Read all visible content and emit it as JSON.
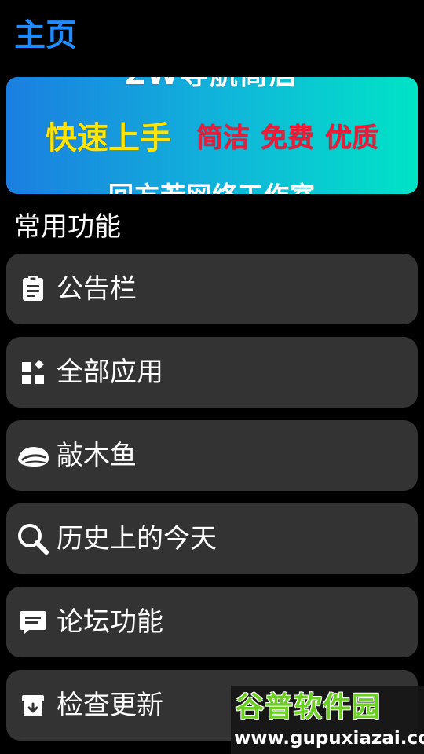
{
  "header": {
    "title": "主页"
  },
  "banner": {
    "top_text": "ZW导航商店",
    "main_text": "快速上手",
    "tags": [
      "简洁",
      "免费",
      "优质"
    ],
    "bottom_text": "回方若网络工作室"
  },
  "section": {
    "title": "常用功能"
  },
  "menu": {
    "items": [
      {
        "label": "公告栏",
        "icon": "clipboard-icon"
      },
      {
        "label": "全部应用",
        "icon": "widgets-icon"
      },
      {
        "label": "敲木鱼",
        "icon": "wooden-fish-icon"
      },
      {
        "label": "历史上的今天",
        "icon": "search-icon"
      },
      {
        "label": "论坛功能",
        "icon": "chat-icon"
      },
      {
        "label": "检查更新",
        "icon": "archive-download-icon"
      }
    ]
  },
  "watermark": {
    "title": "谷普软件园",
    "url": "www.gupuxiazai.com"
  },
  "colors": {
    "header_accent": "#1e8cff",
    "menu_background": "#333333",
    "banner_main": "#ffe400",
    "banner_tag": "#ef1a38",
    "watermark_green": "#6bcf23"
  }
}
